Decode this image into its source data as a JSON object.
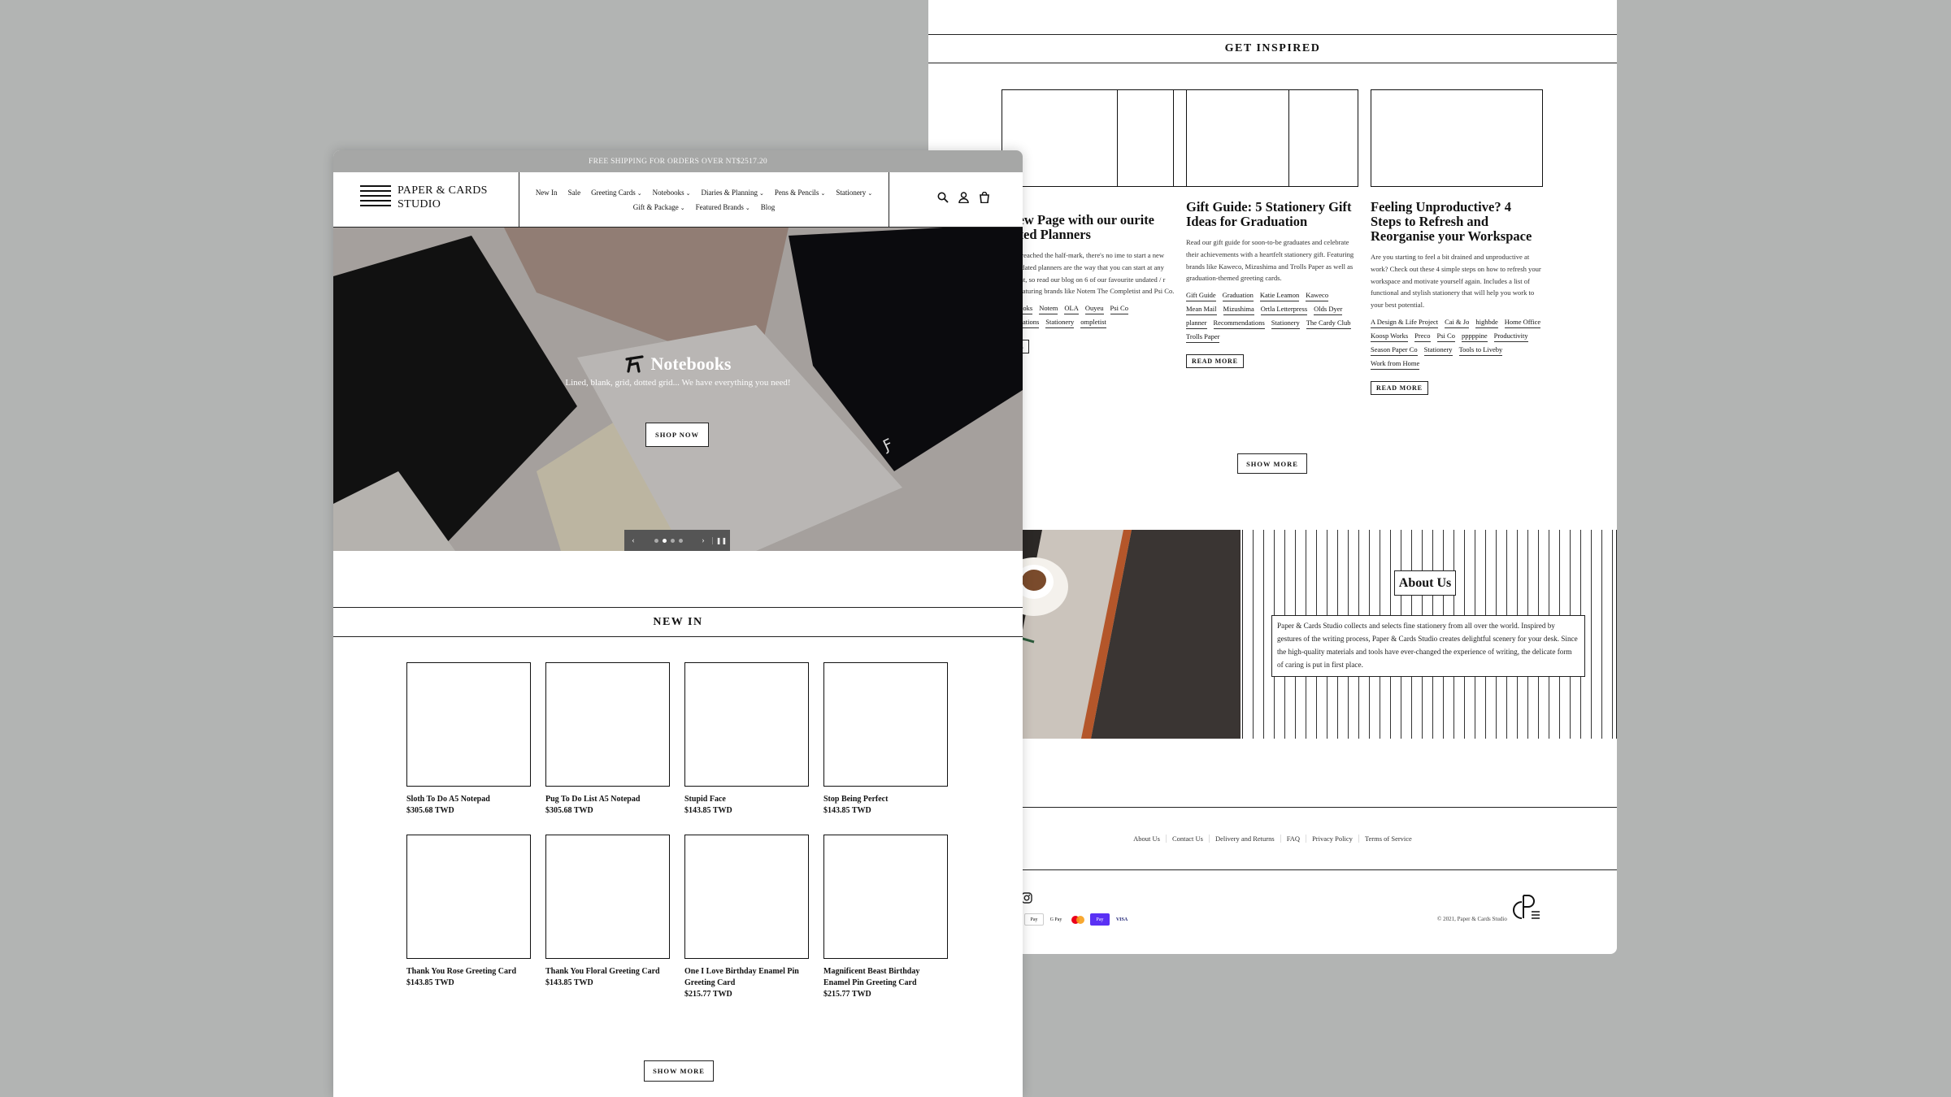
{
  "colors": {
    "background": "#b2b4b3",
    "announcement_bar": "#a6a7a6",
    "text": "#111111"
  },
  "right": {
    "get_inspired": "GET INSPIRED",
    "articles": [
      {
        "title": "n a New Page with our ourite Undated Planners",
        "excerpt": "at 2021 has reached the half-mark, there's no ime to start a new planner! Undated planners are the way that you can start at any day you want, so read our blog on 6 of our favourite undated / r planners! Featuring brands like Notem The Completist and Psi Co.",
        "tags": [
          "lap",
          "Notebooks",
          "Notem",
          "OLA",
          "Ouyeu",
          "Psi Co",
          "Recommendations",
          "Stationery",
          "ompletist"
        ],
        "read_more": "D MORE"
      },
      {
        "title": "Gift Guide: 5 Stationery Gift Ideas for Graduation",
        "excerpt": "Read our gift guide for soon-to-be graduates and celebrate their achievements with a heartfelt stationery gift. Featuring brands like Kaweco, Mizushima and Trolls Paper as well as graduation-themed greeting cards.",
        "tags": [
          "Gift Guide",
          "Graduation",
          "Katie Leamon",
          "Kaweco",
          "Mean Mail",
          "Mizushima",
          "Ortla Letterpress",
          "Olds Dyer",
          "planner",
          "Recommendations",
          "Stationery",
          "The Cardy Club",
          "Trolls Paper"
        ],
        "read_more": "READ MORE"
      },
      {
        "title": "Feeling Unproductive? 4 Steps to Refresh and Reorganise your Workspace",
        "excerpt": "Are you starting to feel a bit drained and unproductive at work? Check out these 4 simple steps on how to refresh your workspace and motivate yourself again. Includes a list of functional and stylish stationery that will help you work to your best potential.",
        "tags": [
          "A Design & Life Project",
          "Cai & Jo",
          "highbde",
          "Home Office",
          "Koosp Works",
          "Preco",
          "Psi Co",
          "pppppine",
          "Productivity",
          "Season Paper Co",
          "Stationery",
          "Tools to Liveby",
          "Work from Home"
        ],
        "read_more": "READ MORE"
      }
    ],
    "show_more": "SHOW MORE",
    "about": {
      "title": "About Us",
      "text": "Paper & Cards Studio collects and selects fine stationery from all over the world. Inspired by gestures of the writing process, Paper & Cards Studio creates delightful scenery for your desk. Since the high-quality materials and tools have ever-changed the experience of writing, the delicate form of caring is put in first place."
    },
    "footer_links": [
      "About Us",
      "Contact Us",
      "Delivery and Returns",
      "FAQ",
      "Privacy Policy",
      "Terms of Service"
    ],
    "payments": [
      "Apple Pay",
      "G Pay",
      "Mastercard",
      "Shop Pay",
      "Visa"
    ],
    "payment_labels": [
      "Pay",
      "G Pay",
      "",
      "Pay",
      "VISA"
    ],
    "copyright": "© 2021, Paper & Cards Studio"
  },
  "left": {
    "announcement": "FREE SHIPPING FOR ORDERS OVER NT$2517.20",
    "logo": {
      "line1": "PAPER & CARDS",
      "line2": "STUDIO"
    },
    "nav_row1": [
      {
        "label": "New In",
        "dropdown": false
      },
      {
        "label": "Sale",
        "dropdown": false
      },
      {
        "label": "Greeting Cards",
        "dropdown": true
      },
      {
        "label": "Notebooks",
        "dropdown": true
      },
      {
        "label": "Diaries & Planning",
        "dropdown": true
      },
      {
        "label": "Pens & Pencils",
        "dropdown": true
      },
      {
        "label": "Stationery",
        "dropdown": true
      }
    ],
    "nav_row2": [
      {
        "label": "Gift & Package",
        "dropdown": true
      },
      {
        "label": "Featured Brands",
        "dropdown": true
      },
      {
        "label": "Blog",
        "dropdown": false
      }
    ],
    "hero": {
      "title": "Notebooks",
      "subtitle": "Lined, blank, grid, dotted grid... We have everything you need!",
      "button": "SHOP NOW",
      "slides": 4,
      "active_slide": 2
    },
    "new_in": "NEW IN",
    "products": [
      {
        "title": "Sloth To Do A5 Notepad",
        "price": "$305.68 TWD"
      },
      {
        "title": "Pug To Do List A5 Notepad",
        "price": "$305.68 TWD"
      },
      {
        "title": "Stupid Face",
        "price": "$143.85 TWD"
      },
      {
        "title": "Stop Being Perfect",
        "price": "$143.85 TWD"
      },
      {
        "title": "Thank You Rose Greeting Card",
        "price": "$143.85 TWD"
      },
      {
        "title": "Thank You Floral Greeting Card",
        "price": "$143.85 TWD"
      },
      {
        "title": "One I Love Birthday Enamel Pin Greeting Card",
        "price": "$215.77 TWD"
      },
      {
        "title": "Magnificent Beast Birthday Enamel Pin Greeting Card",
        "price": "$215.77 TWD"
      }
    ],
    "show_more": "SHOW MORE"
  }
}
